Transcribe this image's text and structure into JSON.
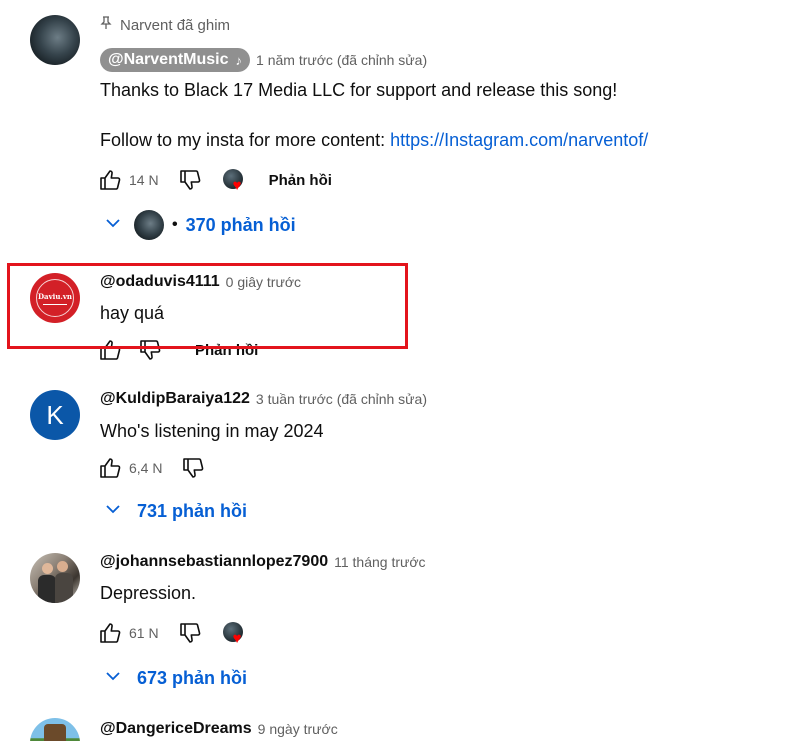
{
  "pinned": {
    "pinned_by": "Narvent đã ghim",
    "author": "@NarventMusic",
    "time": "1 năm trước (đã chỉnh sửa)",
    "text_line1": "Thanks to Black 17 Media LLC for support and release this song!",
    "text_line2_prefix": "Follow to my insta for more content: ",
    "text_link": "https://Instagram.com/narventof/",
    "likes": "14 N",
    "reply_label": "Phản hồi",
    "replies_toggle": "370 phản hồi"
  },
  "comment2": {
    "author": "@odaduvis4111",
    "time": "0 giây trước",
    "text": "hay quá",
    "reply_label": "Phản hồi",
    "avatar_text": "Daviu.vn",
    "avatar_color": "#d32027"
  },
  "comment3": {
    "author": "@KuldipBaraiya122",
    "time": "3 tuần trước (đã chỉnh sửa)",
    "text": "Who's listening in may 2024",
    "likes": "6,4 N",
    "avatar_letter": "K",
    "avatar_color": "#0b57a8",
    "replies_toggle": "731 phản hồi"
  },
  "comment4": {
    "author": "@johannsebastiannlopez7900",
    "time": "11 tháng trước",
    "text": "Depression.",
    "likes": "61 N",
    "replies_toggle": "673 phản hồi"
  },
  "comment5": {
    "author": "@DangericeDreams",
    "time": "9 ngày trước"
  },
  "colors": {
    "link": "#065fd4",
    "highlight": "#e3141c",
    "heart": "#ff0000"
  }
}
